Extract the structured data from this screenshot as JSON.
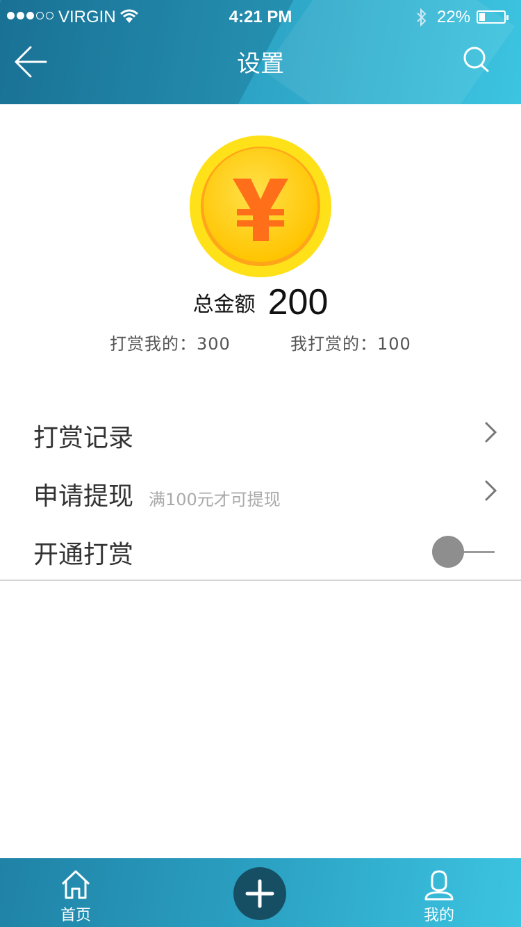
{
  "status_bar": {
    "carrier": "VIRGIN",
    "time": "4:21 PM",
    "battery": "22%",
    "battery_level": 0.22,
    "signal_dots_filled": 3,
    "signal_dots_total": 5
  },
  "navbar": {
    "title": "设置",
    "back_icon": "back-arrow-icon",
    "search_icon": "search-icon"
  },
  "balance": {
    "coin_icon": "yuan-coin-icon",
    "total_label": "总金额",
    "total_value": "200",
    "received_text": "打赏我的：300",
    "given_text": "我打赏的：100"
  },
  "menu": {
    "items": [
      {
        "label": "打赏记录",
        "hint": "",
        "type": "link"
      },
      {
        "label": "申请提现",
        "hint": "满100元才可提现",
        "type": "link"
      },
      {
        "label": "开通打赏",
        "hint": "",
        "type": "toggle",
        "enabled": false
      }
    ]
  },
  "tabbar": {
    "home_label": "首页",
    "add_icon": "plus-icon",
    "me_label": "我的"
  },
  "colors": {
    "header_start": "#1f82a6",
    "header_end": "#3cc4e0",
    "coin_outer": "#ffe119",
    "coin_inner": "#ffcc00",
    "yuan": "#ff6f1a",
    "add_button": "#164f63"
  }
}
